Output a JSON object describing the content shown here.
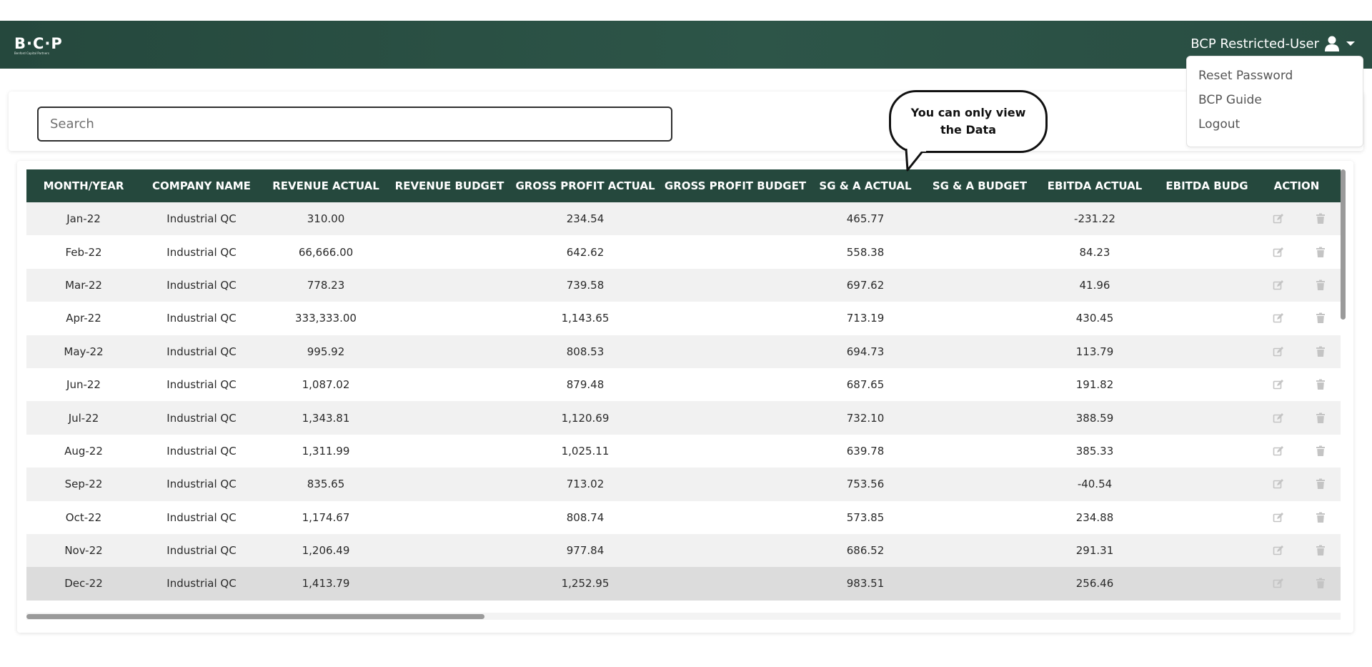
{
  "brand": {
    "logo": "B·C·P",
    "tagline": "Benford Capital Partners"
  },
  "user": {
    "name": "BCP Restricted-User",
    "icon": "user-icon",
    "caret": "chevron-down-icon"
  },
  "dropdown": {
    "items": [
      "Reset Password",
      "BCP Guide",
      "Logout"
    ]
  },
  "search": {
    "placeholder": "Search"
  },
  "tooltip": {
    "text": "You can only view the Data"
  },
  "table": {
    "headers": [
      "MONTH/YEAR",
      "COMPANY NAME",
      "REVENUE ACTUAL",
      "REVENUE BUDGET",
      "GROSS PROFIT ACTUAL",
      "GROSS PROFIT BUDGET",
      "SG & A ACTUAL",
      "SG & A BUDGET",
      "EBITDA ACTUAL",
      "EBITDA BUDG",
      "ACTION"
    ],
    "rows": [
      [
        "Jan-22",
        "Industrial QC",
        "310.00",
        "",
        "234.54",
        "",
        "465.77",
        "",
        "-231.22",
        ""
      ],
      [
        "Feb-22",
        "Industrial QC",
        "66,666.00",
        "",
        "642.62",
        "",
        "558.38",
        "",
        "84.23",
        ""
      ],
      [
        "Mar-22",
        "Industrial QC",
        "778.23",
        "",
        "739.58",
        "",
        "697.62",
        "",
        "41.96",
        ""
      ],
      [
        "Apr-22",
        "Industrial QC",
        "333,333.00",
        "",
        "1,143.65",
        "",
        "713.19",
        "",
        "430.45",
        ""
      ],
      [
        "May-22",
        "Industrial QC",
        "995.92",
        "",
        "808.53",
        "",
        "694.73",
        "",
        "113.79",
        ""
      ],
      [
        "Jun-22",
        "Industrial QC",
        "1,087.02",
        "",
        "879.48",
        "",
        "687.65",
        "",
        "191.82",
        ""
      ],
      [
        "Jul-22",
        "Industrial QC",
        "1,343.81",
        "",
        "1,120.69",
        "",
        "732.10",
        "",
        "388.59",
        ""
      ],
      [
        "Aug-22",
        "Industrial QC",
        "1,311.99",
        "",
        "1,025.11",
        "",
        "639.78",
        "",
        "385.33",
        ""
      ],
      [
        "Sep-22",
        "Industrial QC",
        "835.65",
        "",
        "713.02",
        "",
        "753.56",
        "",
        "-40.54",
        ""
      ],
      [
        "Oct-22",
        "Industrial QC",
        "1,174.67",
        "",
        "808.74",
        "",
        "573.85",
        "",
        "234.88",
        ""
      ],
      [
        "Nov-22",
        "Industrial QC",
        "1,206.49",
        "",
        "977.84",
        "",
        "686.52",
        "",
        "291.31",
        ""
      ],
      [
        "Dec-22",
        "Industrial QC",
        "1,413.79",
        "",
        "1,252.95",
        "",
        "983.51",
        "",
        "256.46",
        ""
      ]
    ],
    "action_icons": [
      "edit-icon",
      "trash-icon"
    ],
    "selected_row": 11
  },
  "colors": {
    "header_bg": "#25483d",
    "topbar_bg": "#2d5548",
    "row_alt": "#f1f1f1",
    "icon_disabled": "#c4c4c4"
  }
}
